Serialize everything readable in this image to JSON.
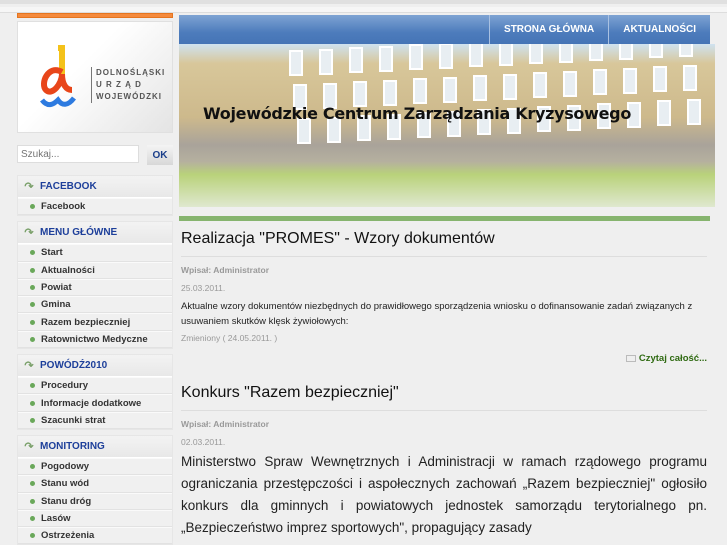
{
  "logo": {
    "lines": [
      "DOLNOŚLĄSKI",
      "U R Z Ą D",
      "WOJEWÓDZKI"
    ]
  },
  "search": {
    "placeholder": "Szukaj...",
    "button": "OK"
  },
  "sidebar": [
    {
      "title": "FACEBOOK",
      "items": [
        "Facebook"
      ]
    },
    {
      "title": "MENU GŁÓWNE",
      "items": [
        "Start",
        "Aktualności",
        "Powiat",
        "Gmina",
        "Razem bezpieczniej",
        "Ratownictwo Medyczne"
      ]
    },
    {
      "title": "POWÓDŹ2010",
      "items": [
        "Procedury",
        "Informacje dodatkowe",
        "Szacunki strat"
      ]
    },
    {
      "title": "MONITORING",
      "items": [
        "Pogodowy",
        "Stanu wód",
        "Stanu dróg",
        "Lasów",
        "Ostrzeżenia"
      ]
    }
  ],
  "nav": [
    "STRONA GŁÓWNA",
    "AKTUALNOŚCI"
  ],
  "banner_title": "Wojewódzkie Centrum Zarządzania Kryzysowego",
  "articles": [
    {
      "title": "Realizacja \"PROMES\" - Wzory dokumentów",
      "author": "Wpisał: Administrator",
      "date": "25.03.2011.",
      "body": "Aktualne wzory dokumentów niezbędnych do prawidłowego sporządzenia wniosku o dofinansowanie zadań związanych z usuwaniem skutków klęsk żywiołowych:",
      "modified": "Zmieniony ( 24.05.2011. )",
      "more": "Czytaj całość..."
    },
    {
      "title": "Konkurs \"Razem bezpieczniej\"",
      "author": "Wpisał: Administrator",
      "date": "02.03.2011.",
      "body": "Ministerstwo Spraw Wewnętrznych i Administracji w ramach rządowego programu ograniczania przestępczości i aspołecznych zachowań „Razem bezpieczniej\" ogłosiło konkurs dla gminnych i powiatowych jednostek samorządu terytorialnego pn. „Bezpieczeństwo imprez sportowych\", propagujący zasady"
    }
  ]
}
